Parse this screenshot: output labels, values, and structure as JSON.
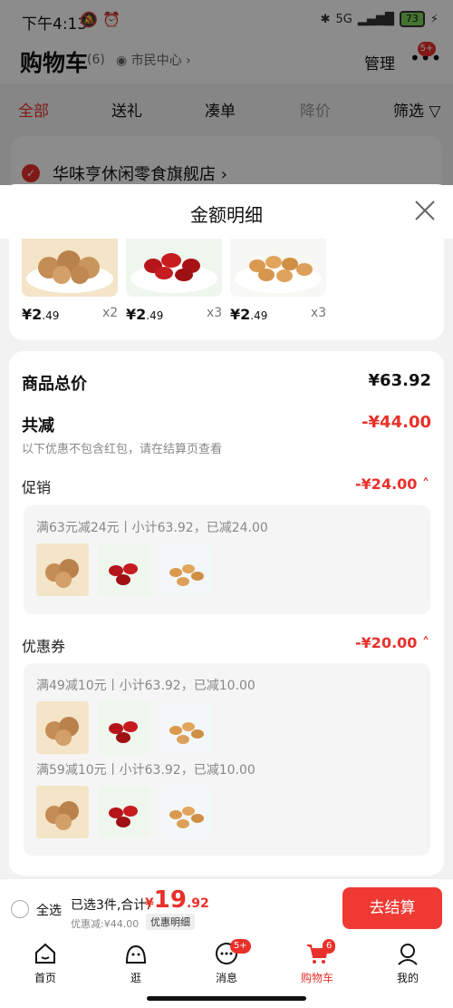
{
  "status_bar": {
    "time": "下午4:13",
    "network": "5G",
    "battery": "73"
  },
  "header": {
    "title": "购物车",
    "count": "(6)",
    "location": "市民中心",
    "manage": "管理",
    "more_badge": "5+"
  },
  "tabs": [
    {
      "label": "全部"
    },
    {
      "label": "送礼"
    },
    {
      "label": "凑单"
    },
    {
      "label": "降价"
    },
    {
      "label": "筛选"
    }
  ],
  "store": {
    "name": "华味亨休闲零食旗舰店"
  },
  "sheet": {
    "title": "金额明细",
    "products": [
      {
        "price_main": "¥2",
        "price_dec": ".49",
        "qty": "x2"
      },
      {
        "price_main": "¥2",
        "price_dec": ".49",
        "qty": "x3"
      },
      {
        "price_main": "¥2",
        "price_dec": ".49",
        "qty": "x3"
      }
    ],
    "total_label": "商品总价",
    "total_value": "¥63.92",
    "reduce_label": "共减",
    "reduce_value": "-¥44.00",
    "reduce_note": "以下优惠不包含红包，请在结算页查看",
    "promo": {
      "label": "促销",
      "value": "-¥24.00",
      "line": "满63元减24元丨小计63.92，已减24.00"
    },
    "coupon": {
      "label": "优惠券",
      "value": "-¥20.00",
      "line1": "满49减10元丨小计63.92，已减10.00",
      "line2": "满59减10元丨小计63.92，已减10.00"
    }
  },
  "checkout": {
    "select_all": "全选",
    "selected": "已选3件,合计:",
    "currency": "¥",
    "total_int": "19",
    "total_dec": ".92",
    "discount": "优惠减:¥44.00",
    "detail_btn": "优惠明细",
    "pay": "去结算"
  },
  "tabbar": [
    {
      "label": "首页"
    },
    {
      "label": "逛"
    },
    {
      "label": "消息",
      "badge": "5+"
    },
    {
      "label": "购物车",
      "badge": "6"
    },
    {
      "label": "我的"
    }
  ],
  "colors": {
    "accent": "#e8312a"
  }
}
